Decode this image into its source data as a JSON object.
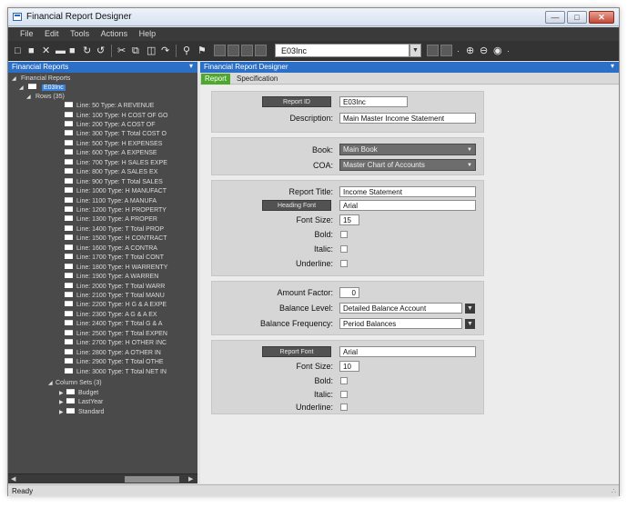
{
  "window": {
    "title": "Financial Report Designer",
    "controls": {
      "minimize": "—",
      "maximize": "□",
      "close": "✕"
    }
  },
  "menu": [
    "File",
    "Edit",
    "Tools",
    "Actions",
    "Help"
  ],
  "toolbar": {
    "report_combo_value": "E03Inc",
    "icons": [
      "new-icon",
      "save-icon",
      "delete-icon",
      "block-icon",
      "refresh-icon",
      "undo-icon",
      "cut-icon",
      "copy-icon",
      "paste-icon",
      "redo-icon",
      "find-icon",
      "tool-icon",
      "add-icon",
      "remove-icon",
      "options-icon"
    ]
  },
  "left_pane": {
    "header": "Financial Reports",
    "tree": {
      "root": "Financial Reports",
      "report": "E03Inc",
      "rows_group": "Rows (35)",
      "rows": [
        "Line: 50 Type: A   REVENUE",
        "Line: 100 Type: H   COST OF GO",
        "Line: 200 Type: A      COST OF",
        "Line: 300 Type: T   Total COST O",
        "Line: 500 Type: H   EXPENSES",
        "Line: 600 Type: A      EXPENSE",
        "Line: 700 Type: H   SALES EXPE",
        "Line: 800 Type: A      SALES EX",
        "Line: 900 Type: T   Total SALES",
        "Line: 1000 Type: H   MANUFACT",
        "Line: 1100 Type: A      MANUFA",
        "Line: 1200 Type: H   PROPERTY",
        "Line: 1300 Type: A      PROPER",
        "Line: 1400 Type: T   Total PROP",
        "Line: 1500 Type: H   CONTRACT",
        "Line: 1600 Type: A      CONTRA",
        "Line: 1700 Type: T   Total CONT",
        "Line: 1800 Type: H   WARRENTY",
        "Line: 1900 Type: A      WARREN",
        "Line: 2000 Type: T   Total WARR",
        "Line: 2100 Type: T   Total MANU",
        "Line: 2200 Type: H   G & A EXPE",
        "Line: 2300 Type: A      G & A EX",
        "Line: 2400 Type: T   Total G & A",
        "Line: 2500 Type: T   Total EXPEN",
        "Line: 2700 Type: H   OTHER INC",
        "Line: 2800 Type: A      OTHER IN",
        "Line: 2900 Type: T   Total OTHE",
        "Line: 3000 Type: T   Total NET IN"
      ],
      "column_sets_group": "Column Sets (3)",
      "column_sets": [
        "Budget",
        "LastYear",
        "Standard"
      ]
    }
  },
  "right_pane": {
    "header": "Financial Report Designer",
    "tabs": [
      "Report",
      "Specification"
    ],
    "active_tab": "Report",
    "report_id": {
      "label": "Report ID",
      "value": "E03Inc"
    },
    "description": {
      "label": "Description:",
      "value": "Main Master Income Statement"
    },
    "book": {
      "label": "Book:",
      "value": "Main Book"
    },
    "coa": {
      "label": "COA:",
      "value": "Master Chart of Accounts"
    },
    "report_title": {
      "label": "Report Title:",
      "value": "Income Statement"
    },
    "heading_font": {
      "label": "Heading Font",
      "value": "Arial"
    },
    "heading_font_size": {
      "label": "Font Size:",
      "value": "15"
    },
    "heading_bold": {
      "label": "Bold:",
      "checked": false
    },
    "heading_italic": {
      "label": "Italic:",
      "checked": false
    },
    "heading_underline": {
      "label": "Underline:",
      "checked": false
    },
    "amount_factor": {
      "label": "Amount Factor:",
      "value": "0"
    },
    "balance_level": {
      "label": "Balance Level:",
      "value": "Detailed Balance Account"
    },
    "balance_frequency": {
      "label": "Balance Frequency:",
      "value": "Period Balances"
    },
    "report_font": {
      "label": "Report Font",
      "value": "Arial"
    },
    "report_font_size": {
      "label": "Font Size:",
      "value": "10"
    },
    "report_bold": {
      "label": "Bold:",
      "checked": false
    },
    "report_italic": {
      "label": "Italic:",
      "checked": false
    },
    "report_underline": {
      "label": "Underline:",
      "checked": false
    }
  },
  "status": {
    "text": "Ready"
  }
}
